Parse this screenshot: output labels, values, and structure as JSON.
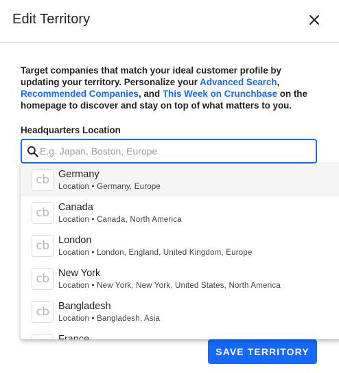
{
  "dialog": {
    "title": "Edit Territory",
    "close_icon": "close-icon"
  },
  "intro": {
    "text_1": "Target companies that match your ideal customer profile by updating your territory. Personalize your ",
    "link_1": "Advanced Search",
    "text_2": ", ",
    "link_2": "Recommended Companies",
    "text_3": ", and ",
    "link_3": "This Week on Crunchbase",
    "text_4": " on the homepage to discover and stay on top of what matters to you."
  },
  "hq": {
    "label": "Headquarters Location",
    "placeholder": "E.g. Japan, Boston, Europe",
    "value": "",
    "icon": "search-icon"
  },
  "logo_text": "cb",
  "options": [
    {
      "name": "Germany",
      "sub": "Location • Germany, Europe"
    },
    {
      "name": "Canada",
      "sub": "Location • Canada, North America"
    },
    {
      "name": "London",
      "sub": "Location • London, England, United Kingdom, Europe"
    },
    {
      "name": "New York",
      "sub": "Location • New York, New York, United States, North America"
    },
    {
      "name": "Bangladesh",
      "sub": "Location • Bangladesh, Asia"
    },
    {
      "name": "France",
      "sub": ""
    }
  ],
  "colors": {
    "accent": "#146aff",
    "highlight_row": "#f5f5f5"
  },
  "footer": {
    "save_label": "SAVE TERRITORY"
  }
}
